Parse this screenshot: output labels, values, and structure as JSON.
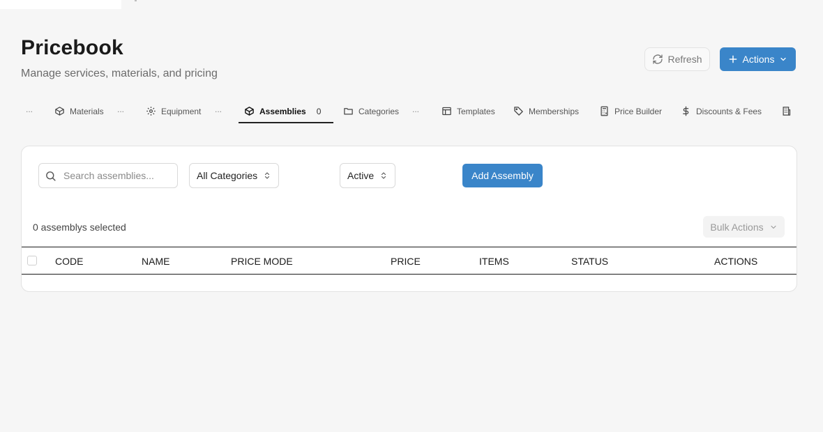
{
  "header": {
    "title": "Pricebook",
    "subtitle": "Manage services, materials, and pricing",
    "refresh_label": "Refresh",
    "actions_label": "Actions"
  },
  "tabs": [
    {
      "label": "Materials",
      "icon": "box-icon"
    },
    {
      "label": "Equipment",
      "icon": "gear-icon"
    },
    {
      "label": "Assemblies",
      "icon": "box-icon",
      "count": "0",
      "active": true
    },
    {
      "label": "Categories",
      "icon": "folder-icon"
    },
    {
      "label": "Templates",
      "icon": "layout-icon"
    },
    {
      "label": "Memberships",
      "icon": "tag-icon"
    },
    {
      "label": "Price Builder",
      "icon": "calculator-icon"
    },
    {
      "label": "Discounts & Fees",
      "icon": "dollar-icon"
    }
  ],
  "tab_overflow": "...",
  "filters": {
    "search_placeholder": "Search assemblies...",
    "category_value": "All Categories",
    "status_value": "Active",
    "add_label": "Add Assembly"
  },
  "selection": {
    "count_text": "0 assemblys selected",
    "bulk_label": "Bulk Actions"
  },
  "table": {
    "columns": [
      "CODE",
      "NAME",
      "PRICE MODE",
      "PRICE",
      "ITEMS",
      "STATUS",
      "ACTIONS"
    ],
    "rows": []
  },
  "colors": {
    "primary": "#3a85c9",
    "background": "#f6f6f6"
  }
}
